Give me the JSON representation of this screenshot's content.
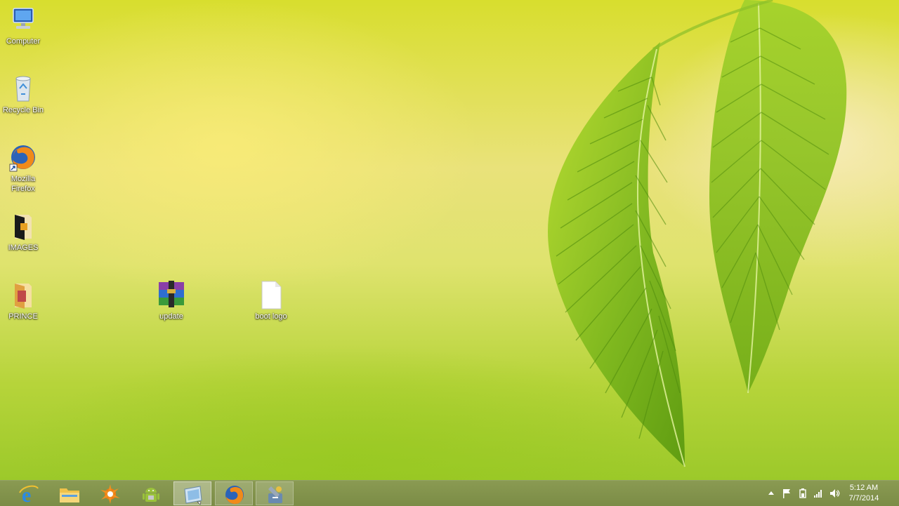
{
  "desktop": {
    "icons": [
      {
        "label": "Computer",
        "icon": "computer-icon"
      },
      {
        "label": "Recycle Bin",
        "icon": "recycle-bin-icon"
      },
      {
        "label": "Mozilla Firefox",
        "icon": "firefox-icon"
      },
      {
        "label": "IMAGES",
        "icon": "folder-icon"
      },
      {
        "label": "PRINCE",
        "icon": "folder-icon"
      },
      {
        "label": "update",
        "icon": "winrar-archive-icon"
      },
      {
        "label": "boot logo",
        "icon": "blank-file-icon"
      }
    ]
  },
  "taskbar": {
    "buttons": [
      {
        "name": "internet-explorer",
        "icon": "internet-explorer-icon"
      },
      {
        "name": "file-explorer",
        "icon": "file-explorer-icon"
      },
      {
        "name": "avast",
        "icon": "avast-icon"
      },
      {
        "name": "android-tool",
        "icon": "android-icon"
      },
      {
        "name": "image-viewer",
        "icon": "window-app-icon",
        "state": "current"
      },
      {
        "name": "firefox",
        "icon": "firefox-icon",
        "state": "active"
      },
      {
        "name": "flash-tool",
        "icon": "flash-tool-icon",
        "state": "active"
      }
    ],
    "tray": {
      "icons": [
        "show-hidden-icons",
        "action-center-flag-icon",
        "power-icon",
        "network-signal-icon",
        "volume-icon"
      ],
      "time": "5:12 AM",
      "date": "7/7/2014"
    }
  },
  "colors": {
    "taskbar": "#7b8c46",
    "wallpaper_primary": "#d8de2e",
    "leaf": "#7fb51a"
  }
}
